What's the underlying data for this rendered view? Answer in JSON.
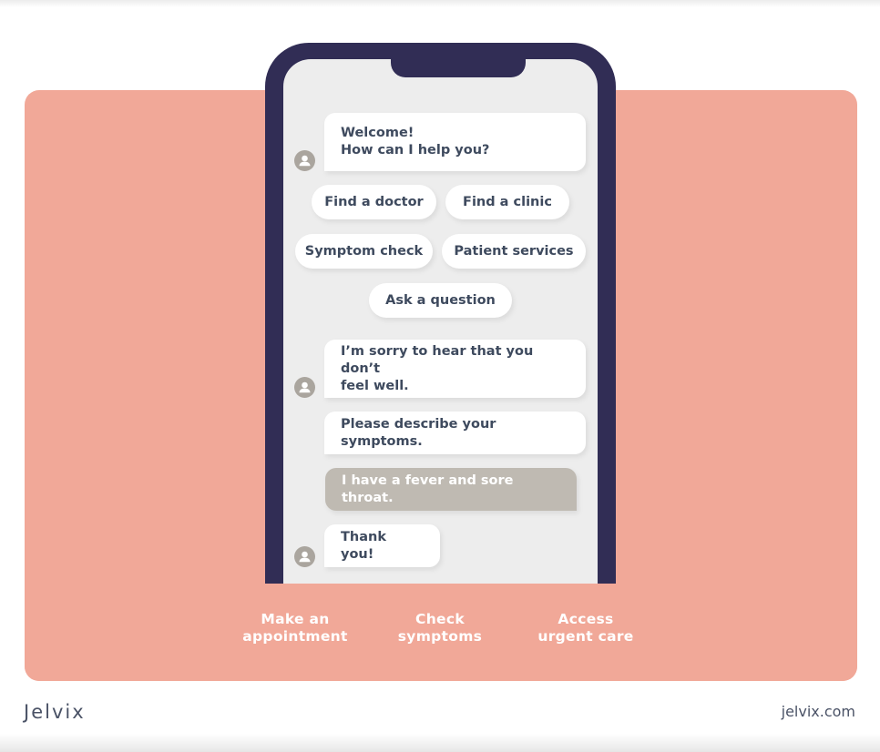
{
  "colors": {
    "panel": "#f1a898",
    "phone_frame": "#312d55",
    "screen": "#ededed",
    "bubble_bot": "#ffffff",
    "bubble_user": "#bfbab2",
    "text_dark": "#3e4a5e",
    "avatar": "#aaa59e"
  },
  "chat": {
    "welcome": {
      "line1": "Welcome!",
      "line2": "How can I help you?"
    },
    "quick_replies": [
      "Find a doctor",
      "Find a clinic",
      "Symptom check",
      "Patient services",
      "Ask a question"
    ],
    "sorry": {
      "line1": "I’m sorry to hear that you don’t",
      "line2": "feel well."
    },
    "describe": "Please describe your symptoms.",
    "user_message": "I have a fever and sore throat.",
    "thanks": "Thank you!"
  },
  "features": [
    {
      "line1": "Make an",
      "line2": "appointment"
    },
    {
      "line1": "Check",
      "line2": "symptoms"
    },
    {
      "line1": "Access",
      "line2": "urgent care"
    }
  ],
  "footer": {
    "logo": "Jelvix",
    "website": "jelvix.com"
  },
  "icons": {
    "avatar": "user-avatar-icon"
  }
}
